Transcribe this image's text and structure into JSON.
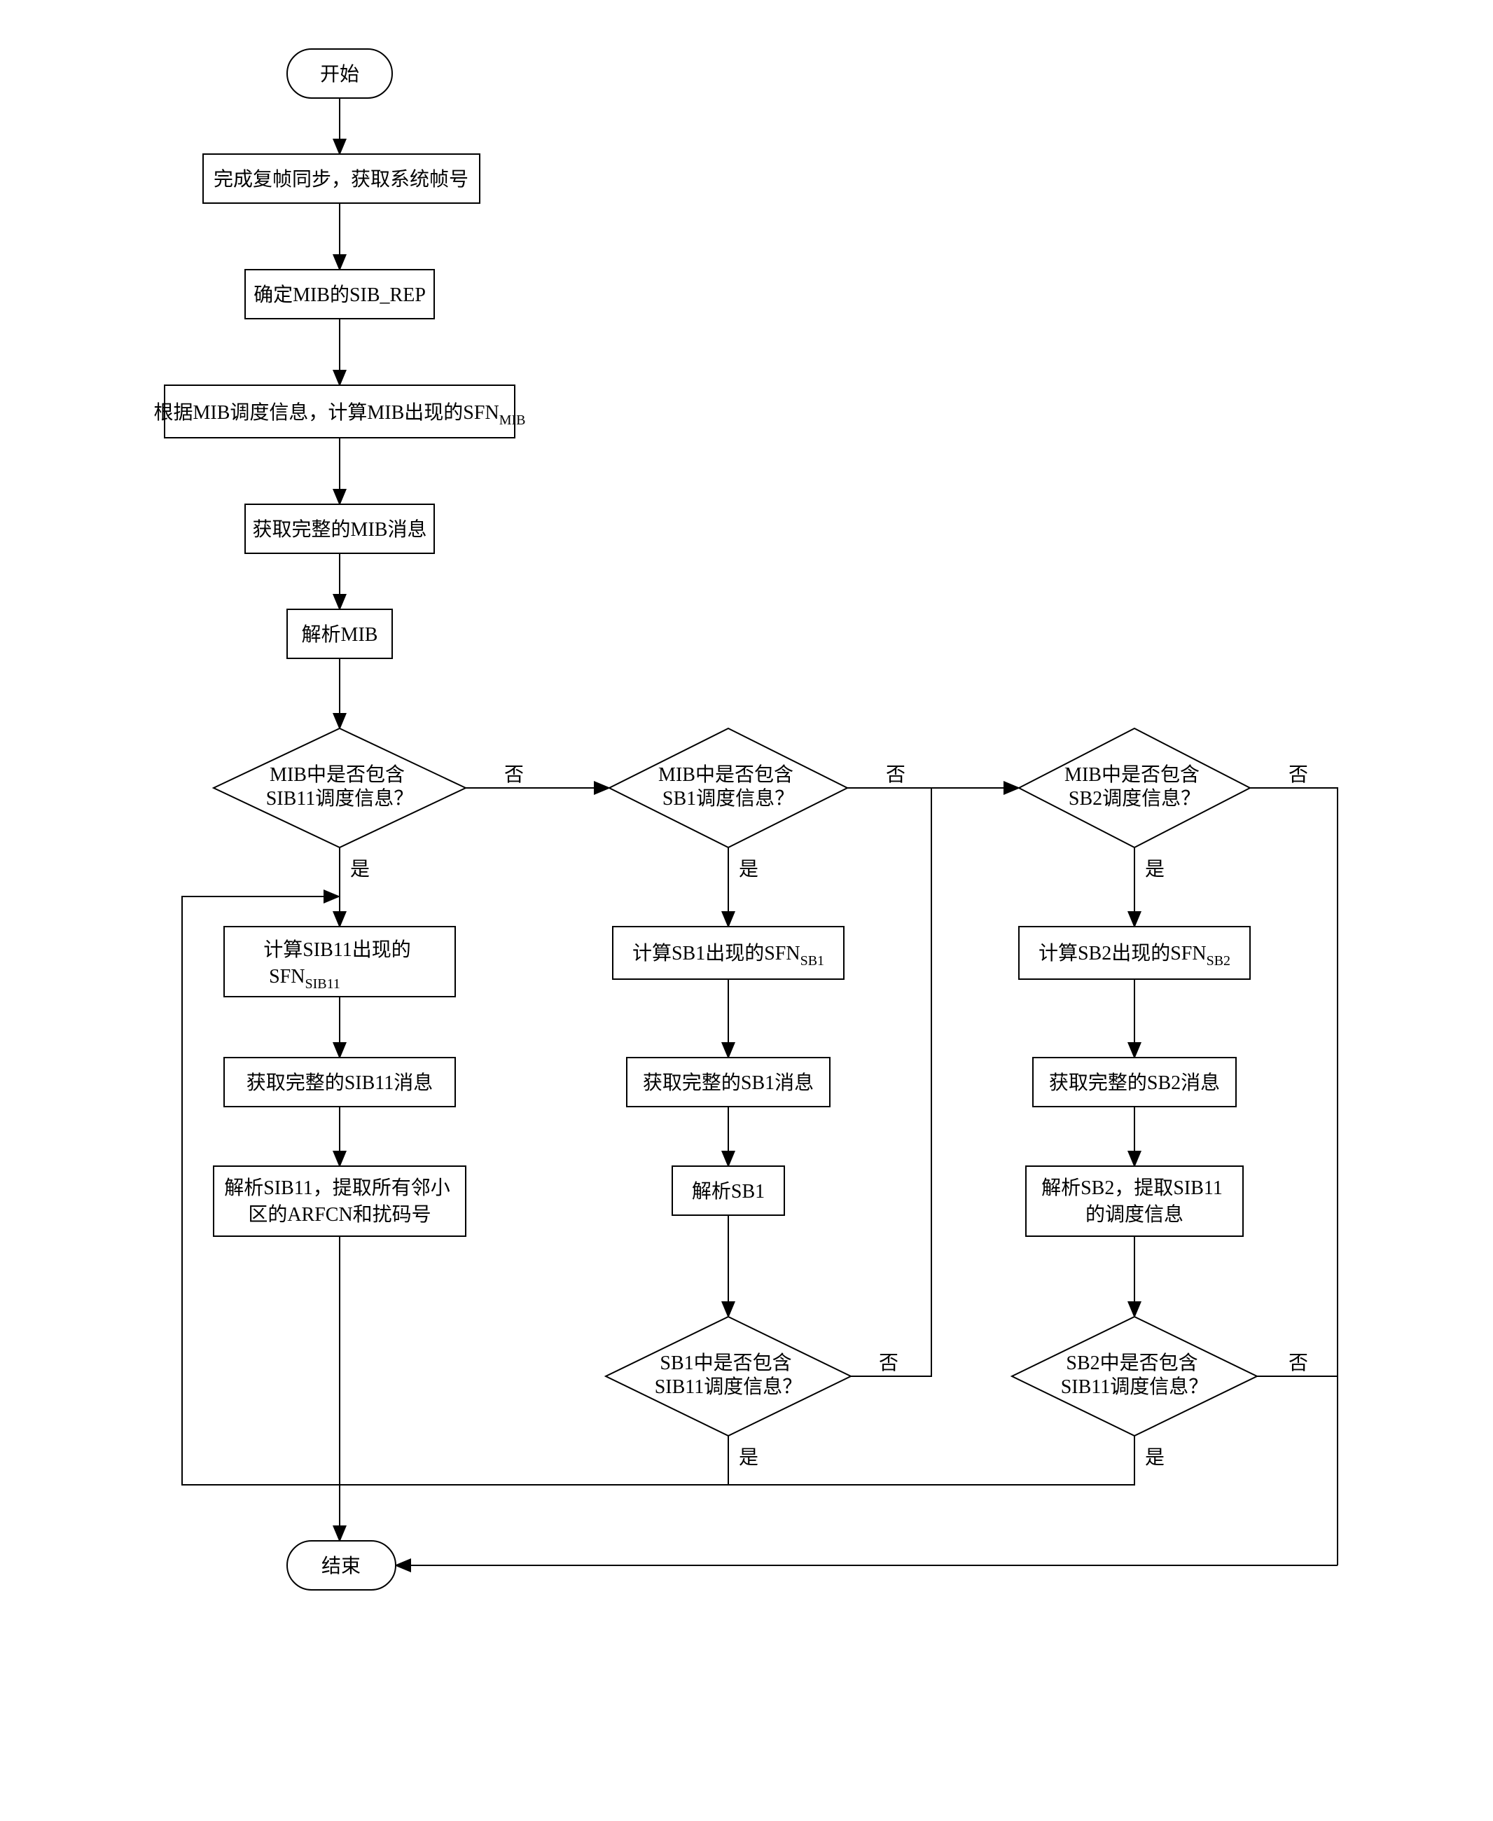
{
  "start": "开始",
  "end": "结束",
  "step1": "完成复帧同步，获取系统帧号",
  "step2": "确定MIB的SIB_REP",
  "step3_a": "根据MIB调度信息，计算MIB出现的SFN",
  "step3_sub": "MIB",
  "step4": "获取完整的MIB消息",
  "step5": "解析MIB",
  "dec1_a": "MIB中是否包含",
  "dec1_b": "SIB11调度信息？",
  "dec2_a": "MIB中是否包含",
  "dec2_b": "SB1调度信息？",
  "dec3_a": "MIB中是否包含",
  "dec3_b": "SB2调度信息？",
  "col1_s1_a": "计算SIB11出现的",
  "col1_s1_b": "SFN",
  "col1_s1_sub": "SIB11",
  "col1_s2": "获取完整的SIB11消息",
  "col1_s3_a": "解析SIB11，提取所有邻小",
  "col1_s3_b": "区的ARFCN和扰码号",
  "col2_s1_a": "计算SB1出现的SFN",
  "col2_s1_sub": "SB1",
  "col2_s2": "获取完整的SB1消息",
  "col2_s3": "解析SB1",
  "col2_dec_a": "SB1中是否包含",
  "col2_dec_b": "SIB11调度信息？",
  "col3_s1_a": "计算SB2出现的SFN",
  "col3_s1_sub": "SB2",
  "col3_s2": "获取完整的SB2消息",
  "col3_s3_a": "解析SB2，提取SIB11",
  "col3_s3_b": "的调度信息",
  "col3_dec_a": "SB2中是否包含",
  "col3_dec_b": "SIB11调度信息？",
  "yes": "是",
  "no": "否"
}
